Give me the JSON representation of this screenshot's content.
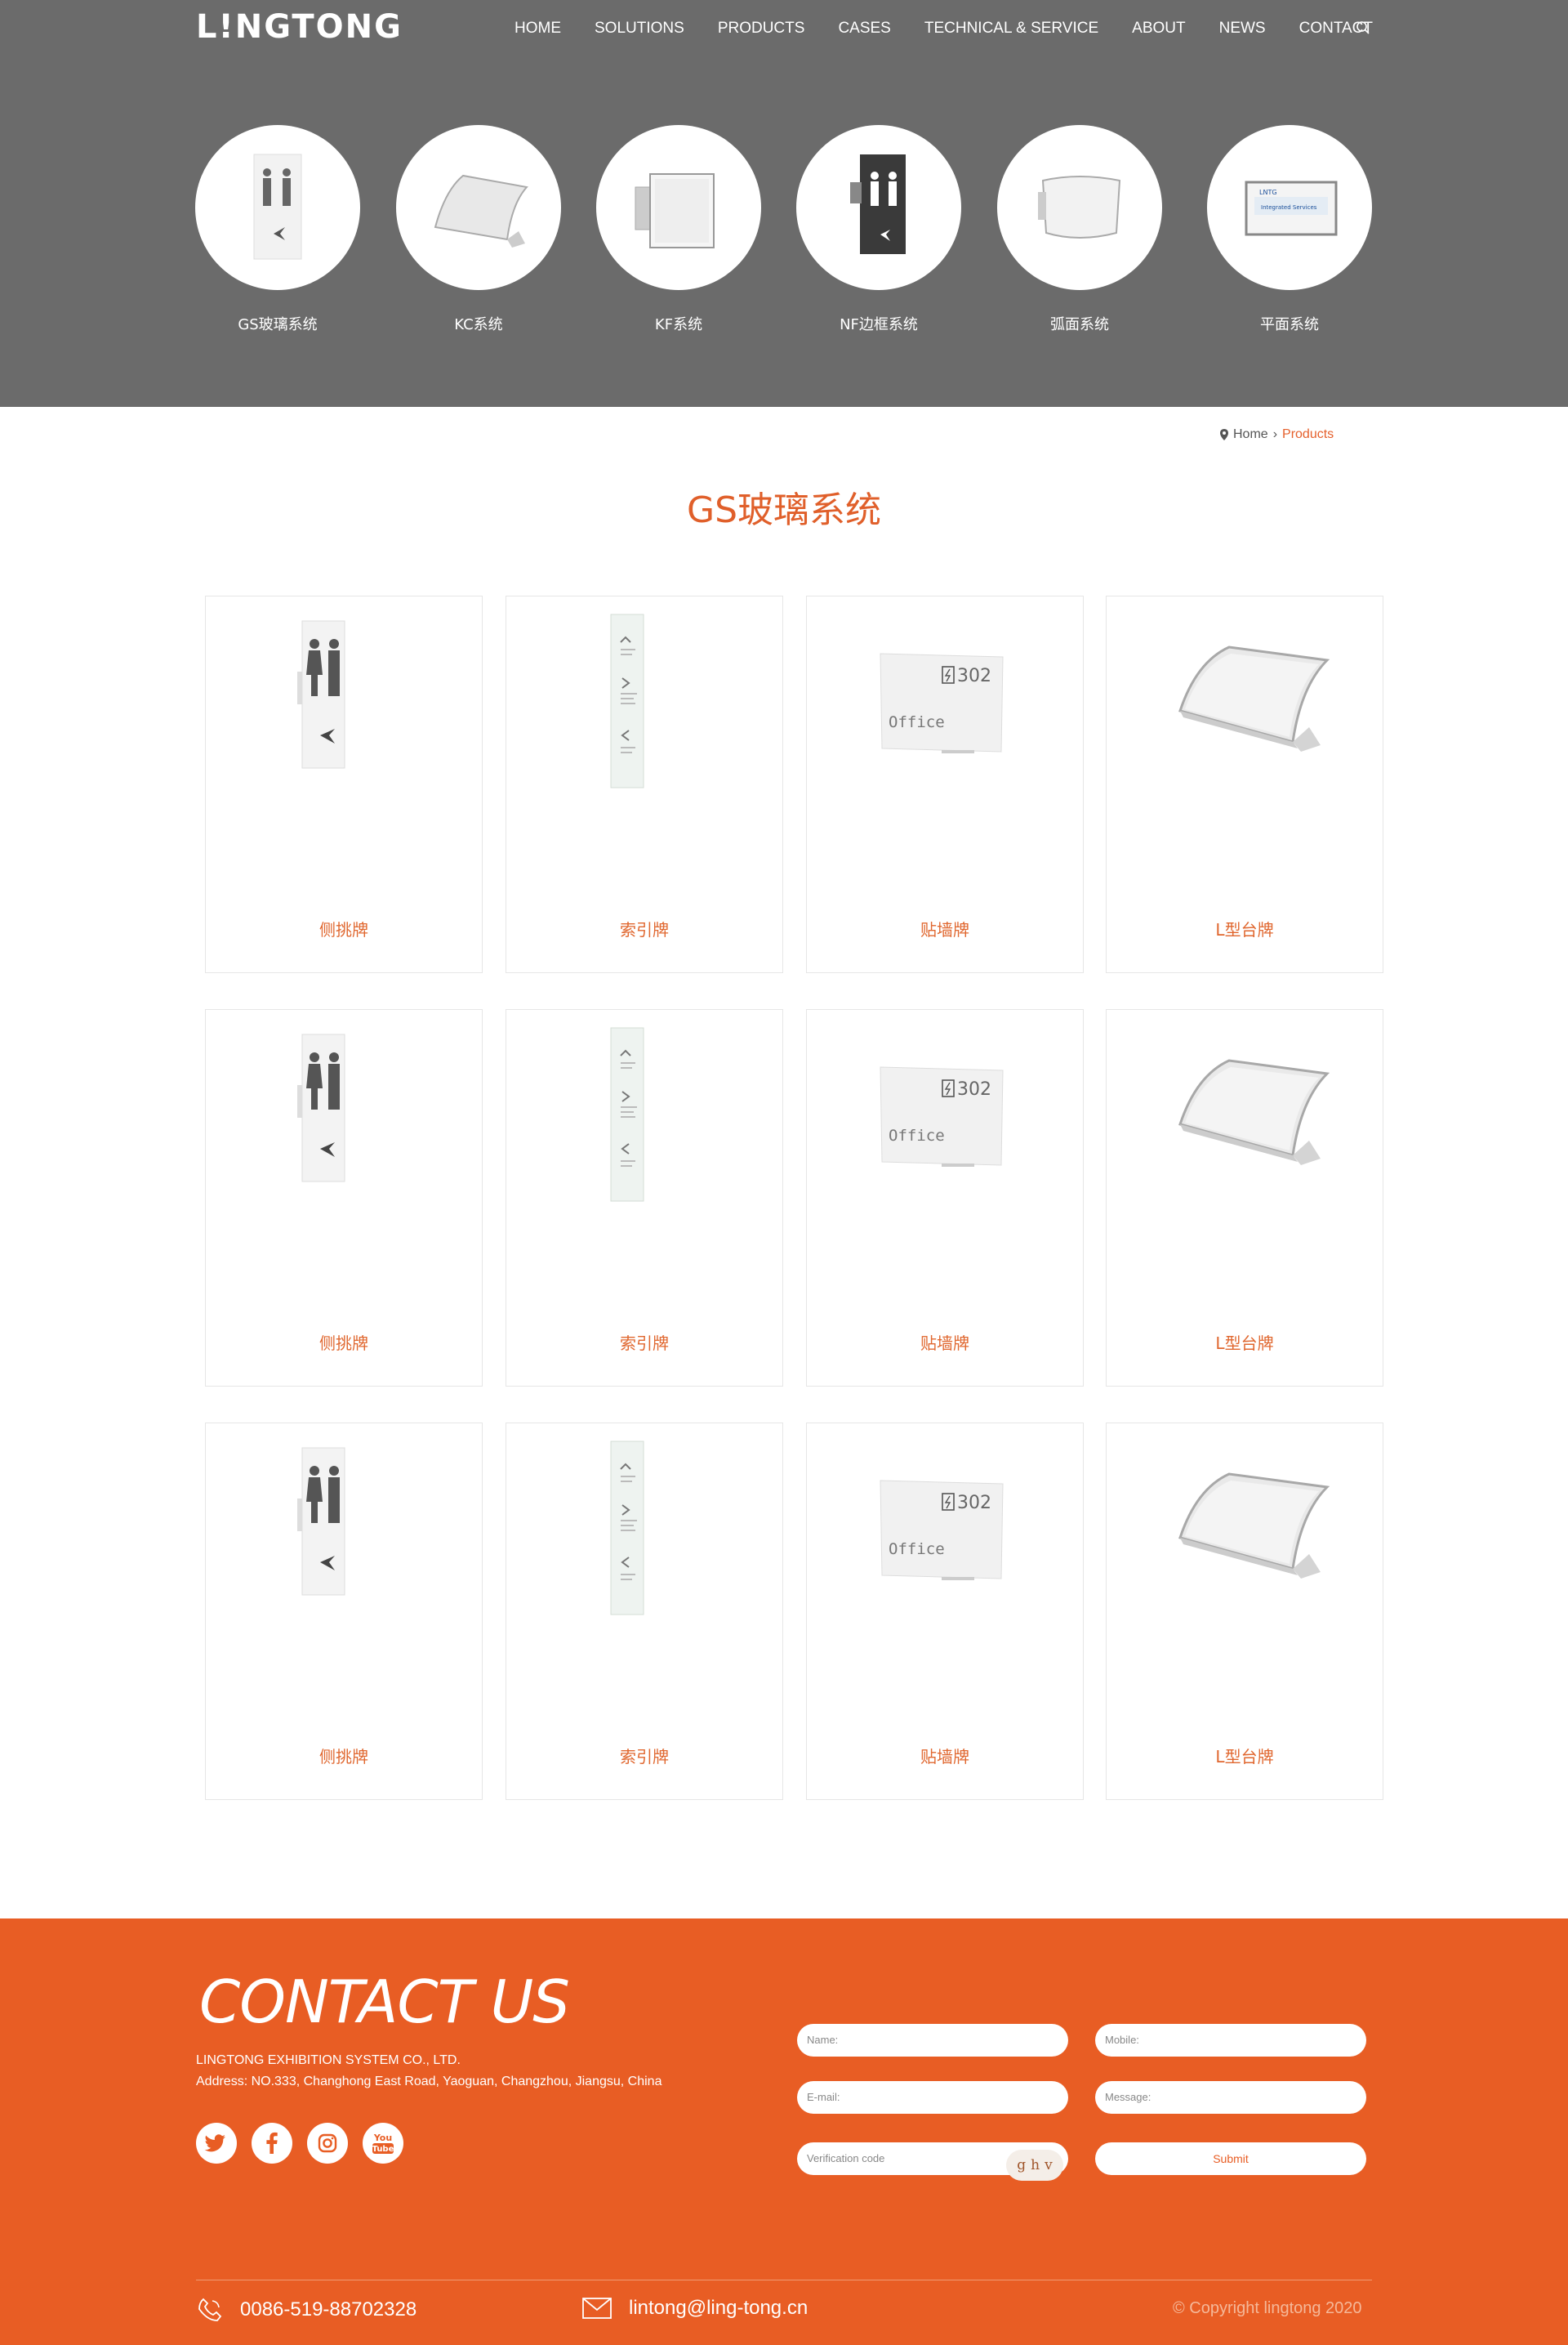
{
  "header": {
    "logo_text": "L!NGTONG",
    "nav": [
      "HOME",
      "SOLUTIONS",
      "PRODUCTS",
      "CASES",
      "TECHNICAL & SERVICE",
      "ABOUT",
      "NEWS",
      "CONTACT"
    ],
    "search_icon": "search-icon"
  },
  "categories": [
    {
      "label": "GS玻璃系统",
      "icon": "restroom-sign"
    },
    {
      "label": "KC系统",
      "icon": "curved-desk-sign"
    },
    {
      "label": "KF系统",
      "icon": "flag-sign"
    },
    {
      "label": "NF边框系统",
      "icon": "framed-restroom-sign"
    },
    {
      "label": "弧面系统",
      "icon": "curved-wall-sign"
    },
    {
      "label": "平面系统",
      "icon": "flat-sign"
    }
  ],
  "breadcrumb": {
    "home": "Home",
    "separator": "›",
    "current": "Products"
  },
  "page_title": "GS玻璃系统",
  "products": [
    {
      "label": "侧挑牌",
      "image": "restroom-side-sign"
    },
    {
      "label": "索引牌",
      "image": "directory-sign"
    },
    {
      "label": "贴墙牌",
      "image": "office-302-sign"
    },
    {
      "label": "L型台牌",
      "image": "curved-desk-sign"
    },
    {
      "label": "侧挑牌",
      "image": "restroom-side-sign"
    },
    {
      "label": "索引牌",
      "image": "directory-sign"
    },
    {
      "label": "贴墙牌",
      "image": "office-302-sign"
    },
    {
      "label": "L型台牌",
      "image": "curved-desk-sign"
    },
    {
      "label": "侧挑牌",
      "image": "restroom-side-sign"
    },
    {
      "label": "索引牌",
      "image": "directory-sign"
    },
    {
      "label": "贴墙牌",
      "image": "office-302-sign"
    },
    {
      "label": "L型台牌",
      "image": "curved-desk-sign"
    }
  ],
  "sign_text": {
    "room_number": "302",
    "room_name": "Office",
    "flat_brand": "LNTG",
    "flat_caption": "Integrated Services"
  },
  "footer": {
    "title": "CONTACT US",
    "company": "LINGTONG EXHIBITION SYSTEM CO., LTD.",
    "address": "Address: NO.333, Changhong East Road, Yaoguan, Changzhou, Jiangsu, China",
    "socials": [
      "twitter-icon",
      "facebook-icon",
      "instagram-icon",
      "youtube-icon"
    ],
    "youtube_text": [
      "You",
      "Tube"
    ],
    "form": {
      "name_placeholder": "Name:",
      "mobile_placeholder": "Mobile:",
      "email_placeholder": "E-mail:",
      "message_placeholder": "Message:",
      "verification_placeholder": "Verification code",
      "captcha": [
        "g",
        "h",
        "v"
      ],
      "submit": "Submit"
    },
    "phone": "0086-519-88702328",
    "email": "lintong@ling-tong.cn",
    "copyright": "© Copyright lingtong 2020"
  },
  "colors": {
    "accent": "#e85d24",
    "header_bg": "#6b6b6b",
    "title": "#e05f2a"
  }
}
